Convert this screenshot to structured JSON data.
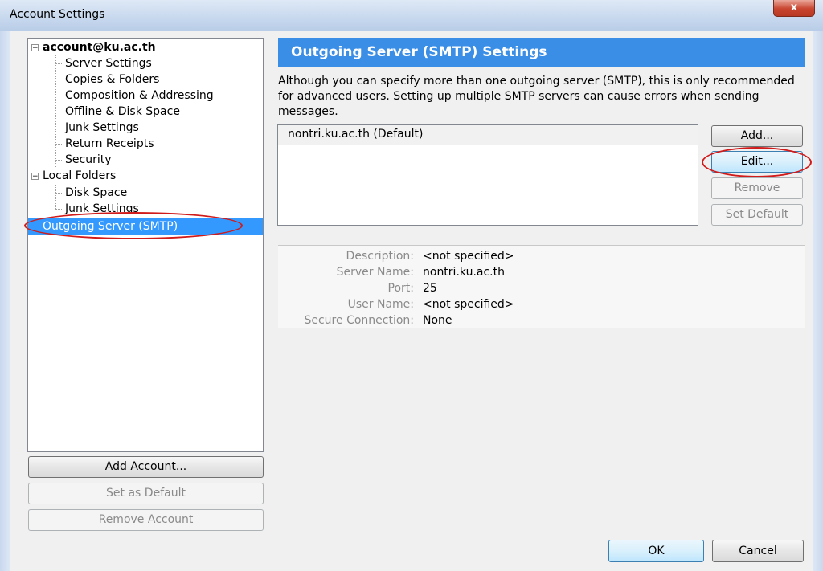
{
  "window": {
    "title": "Account Settings",
    "close_label": "x"
  },
  "tree": {
    "account": {
      "label": "account@ku.ac.th",
      "children": [
        "Server Settings",
        "Copies & Folders",
        "Composition & Addressing",
        "Offline & Disk Space",
        "Junk Settings",
        "Return Receipts",
        "Security"
      ]
    },
    "local_folders": {
      "label": "Local Folders",
      "children": [
        "Disk Space",
        "Junk Settings"
      ]
    },
    "outgoing": {
      "label": "Outgoing Server (SMTP)"
    }
  },
  "left_buttons": {
    "add_account": "Add Account...",
    "set_default": "Set as Default",
    "remove_account": "Remove Account"
  },
  "main": {
    "header": "Outgoing Server (SMTP) Settings",
    "description": "Although you can specify more than one outgoing server (SMTP), this is only recommended for advanced users. Setting up multiple SMTP servers can cause errors when sending messages.",
    "servers": [
      "nontri.ku.ac.th (Default)"
    ],
    "buttons": {
      "add": "Add...",
      "edit": "Edit...",
      "remove": "Remove",
      "set_default": "Set Default"
    },
    "details": [
      {
        "label": "Description:",
        "value": "<not specified>"
      },
      {
        "label": "Server Name:",
        "value": "nontri.ku.ac.th"
      },
      {
        "label": "Port:",
        "value": "25"
      },
      {
        "label": "User Name:",
        "value": "<not specified>"
      },
      {
        "label": "Secure Connection:",
        "value": "None"
      }
    ]
  },
  "footer": {
    "ok": "OK",
    "cancel": "Cancel"
  },
  "colors": {
    "header_blue": "#3a8ee6",
    "selection_blue": "#3399ff",
    "annotation_red": "#d11a1a"
  }
}
